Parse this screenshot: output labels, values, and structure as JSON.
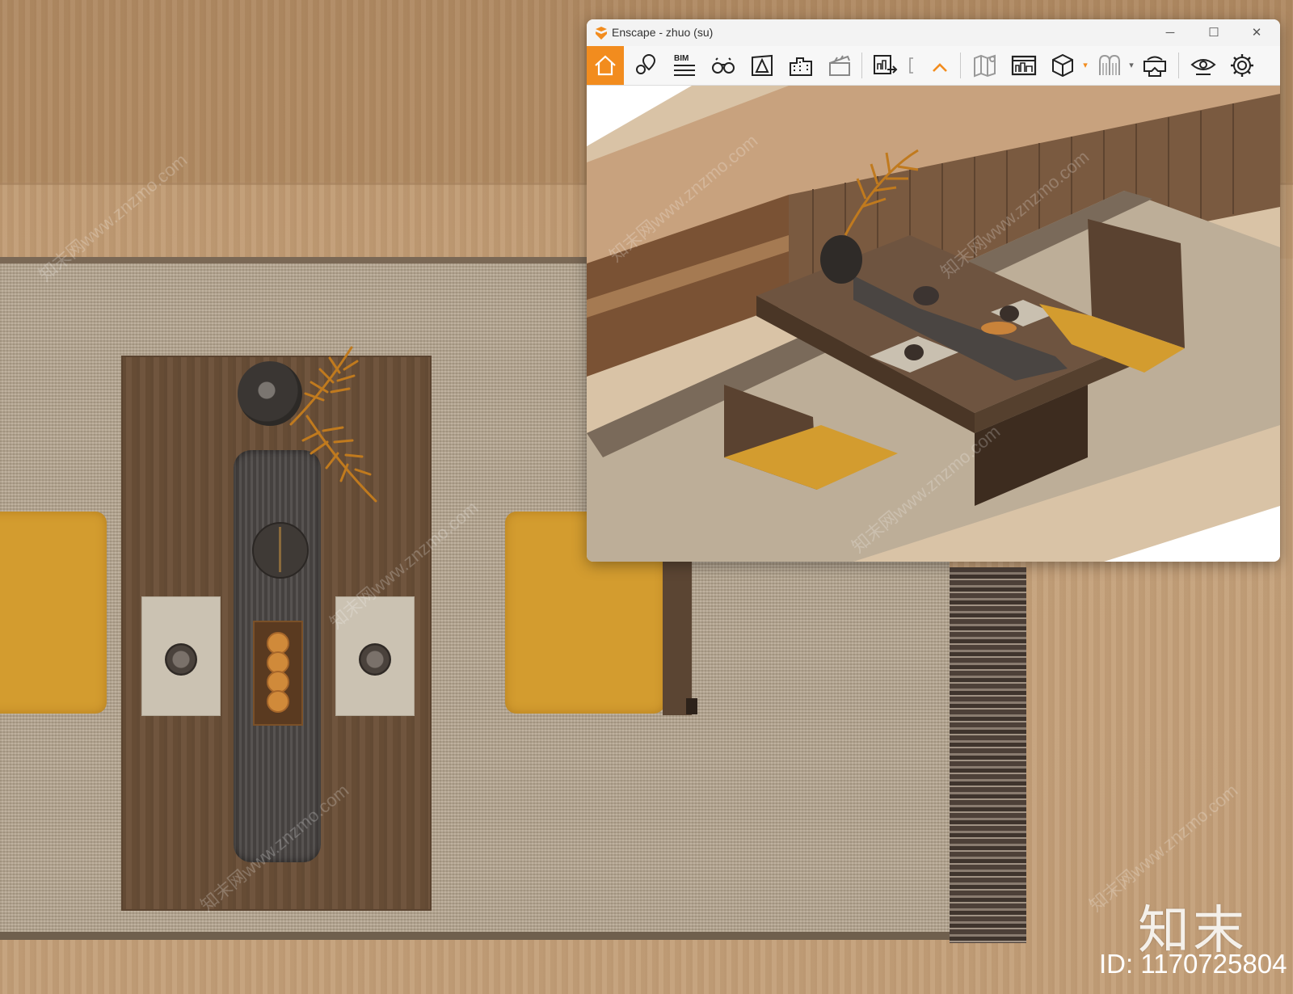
{
  "window": {
    "title": "Enscape - zhuo (su)",
    "controls": {
      "minimize": "─",
      "maximize": "☐",
      "close": "✕"
    }
  },
  "toolbar": {
    "bim_label": "BIM",
    "items": [
      "home-icon",
      "location-pin-icon",
      "bim-icon",
      "binoculars-icon",
      "site-context-icon",
      "buildings-icon",
      "clapperboard-icon",
      "render-export-icon",
      "bracket-icon",
      "collapse-chevron-icon",
      "map-icon",
      "panorama-icon",
      "cube-icon",
      "chevron-down-icon",
      "asset-library-icon",
      "chevron-down-icon",
      "vr-headset-icon",
      "visual-settings-eye-icon",
      "gear-icon"
    ]
  },
  "colors": {
    "accent": "#f28c1e",
    "cushion": "#d39c2f",
    "table_wood": "#6b5038",
    "rug": "#b4a48e",
    "floor": "#c4a07a"
  },
  "watermark": {
    "text": "知末网www.znzmo.com"
  },
  "brand": {
    "logo_text": "知末",
    "id_text": "ID: 1170725804"
  }
}
